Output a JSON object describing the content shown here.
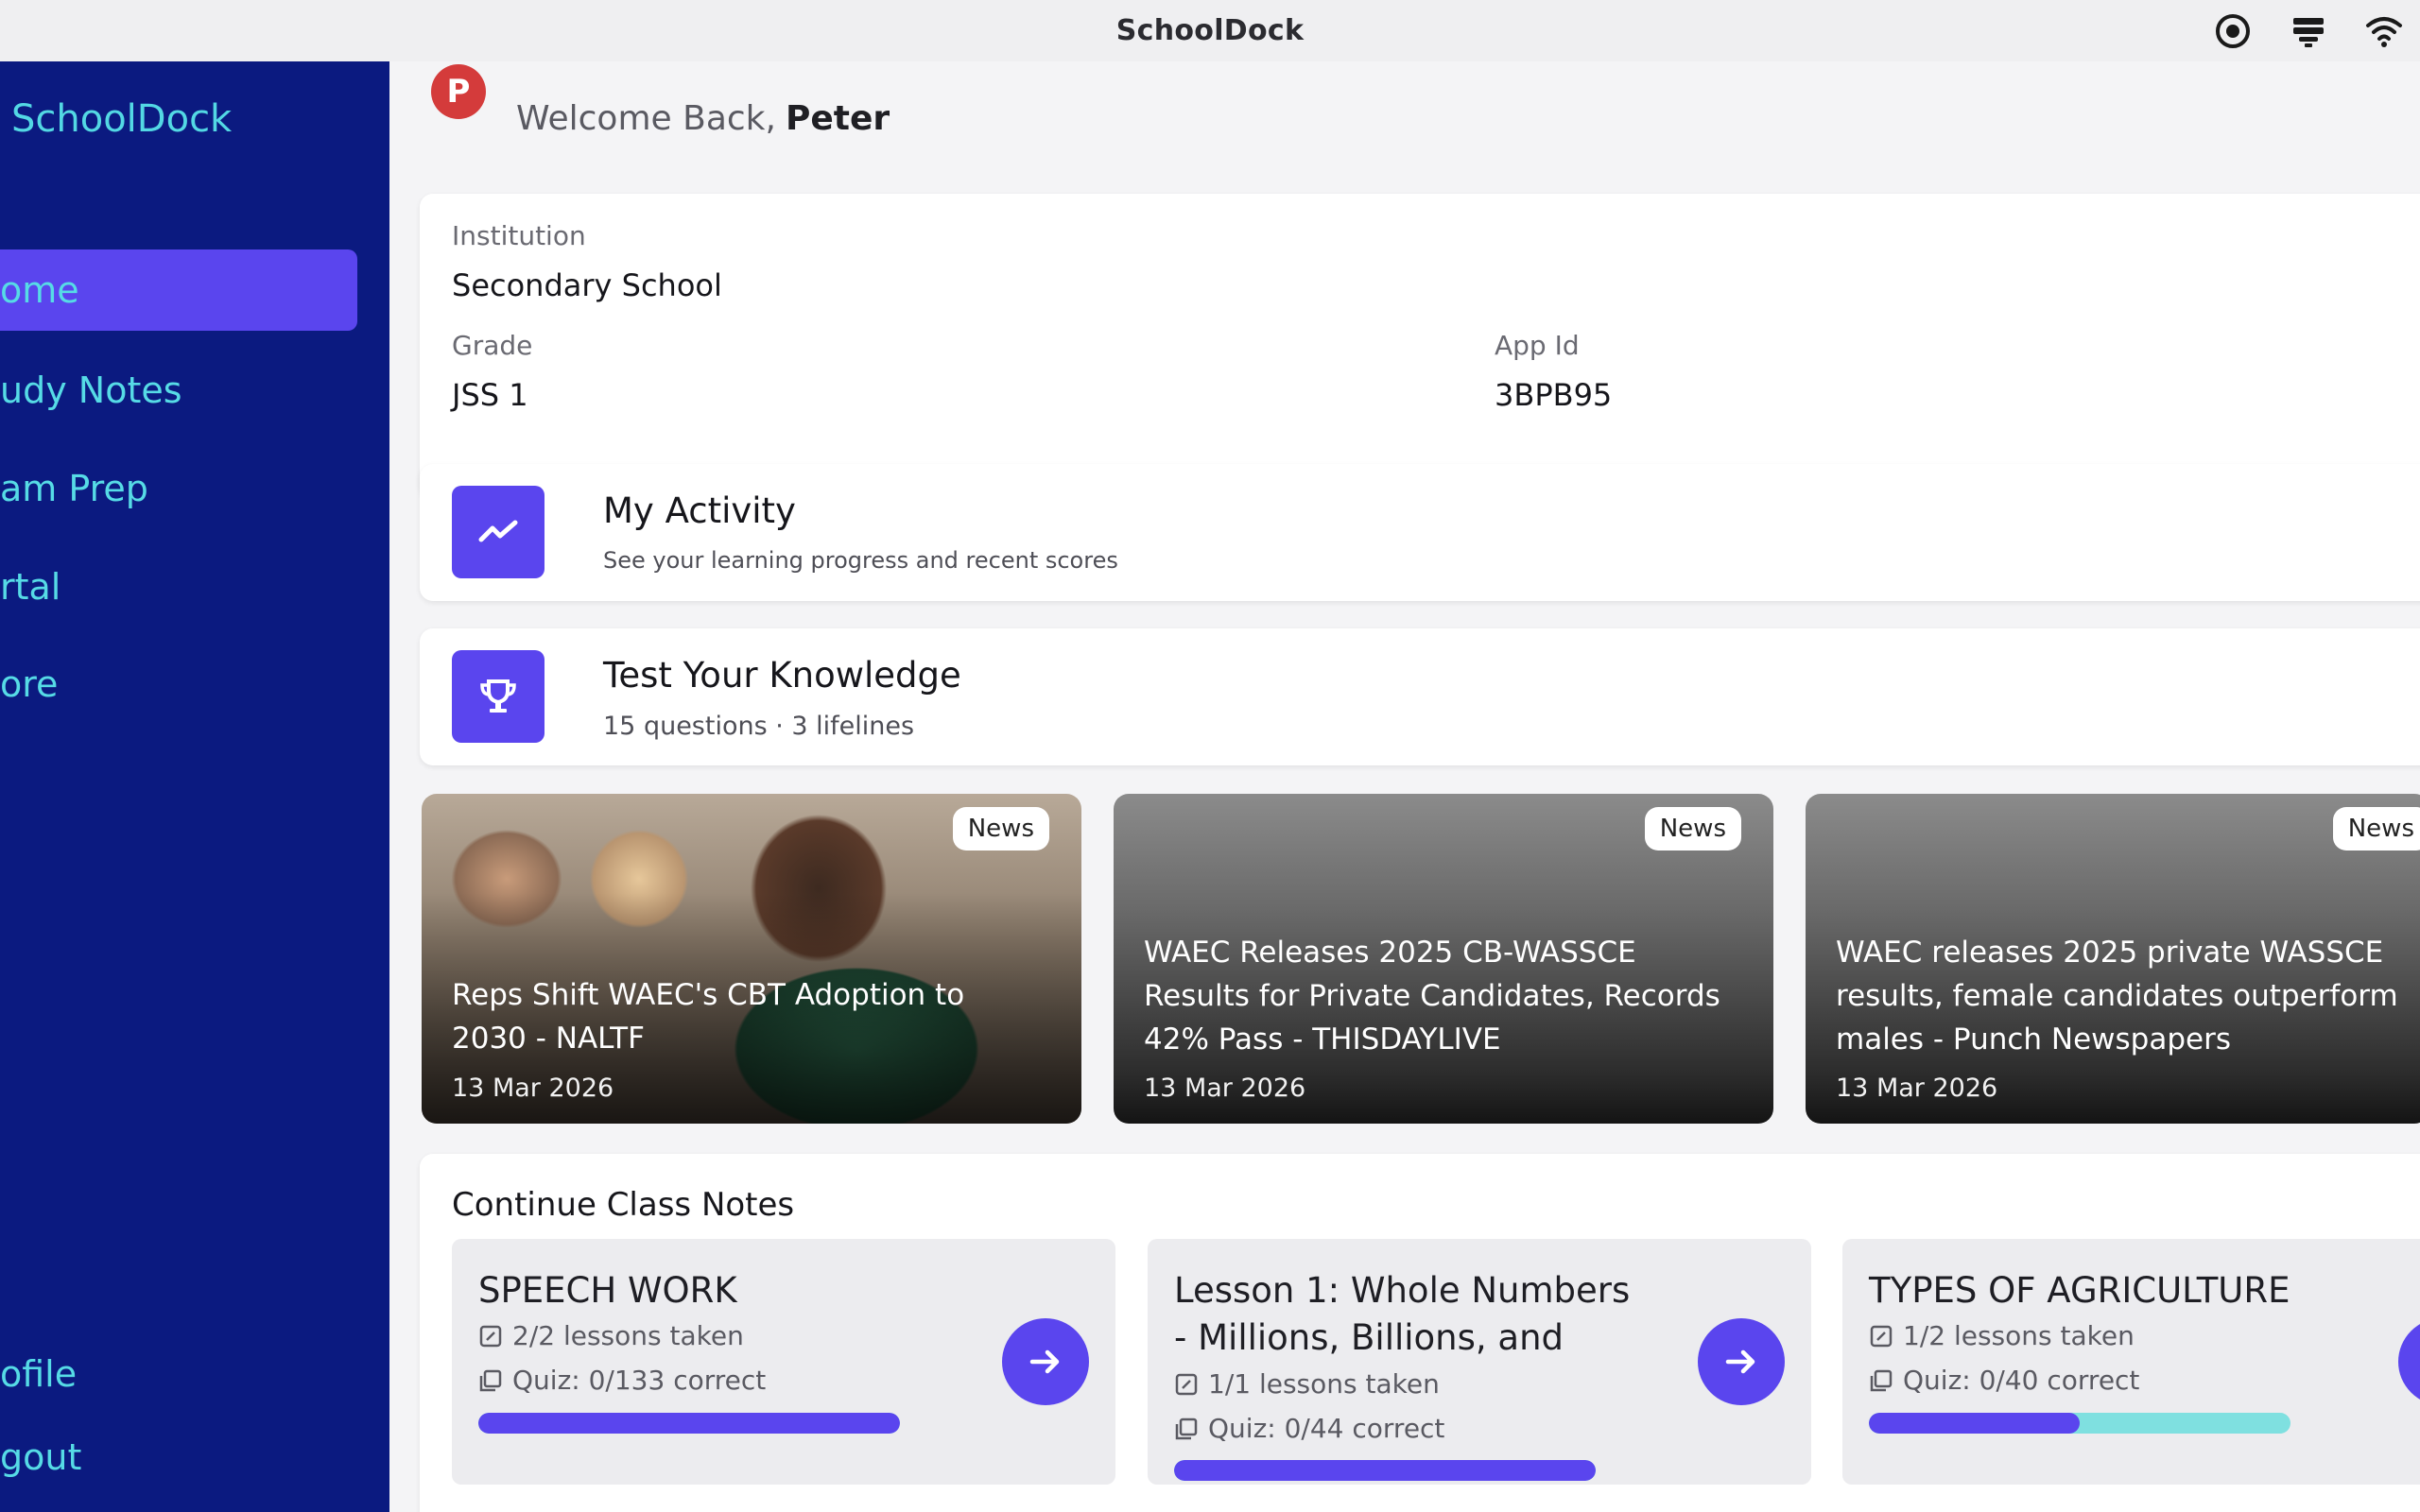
{
  "app": {
    "title": "SchoolDock"
  },
  "topbar": {
    "icons": [
      "record-icon",
      "server-icon",
      "wifi-icon"
    ]
  },
  "sidebar": {
    "brand": "SchoolDock",
    "items": [
      {
        "label": "ome",
        "icon": "home",
        "active": true
      },
      {
        "label": "udy Notes",
        "icon": "notes",
        "active": false
      },
      {
        "label": "am Prep",
        "icon": "exam",
        "active": false
      },
      {
        "label": "rtal",
        "icon": "portal",
        "active": false
      },
      {
        "label": "ore",
        "icon": "more",
        "active": false
      }
    ],
    "bottom_items": [
      {
        "label": "ofile"
      },
      {
        "label": "gout"
      }
    ]
  },
  "header": {
    "avatar_letter": "P",
    "welcome_text": "Welcome Back,",
    "user_name": "Peter"
  },
  "profile": {
    "institution_label": "Institution",
    "institution_value": "Secondary School",
    "grade_label": "Grade",
    "grade_value": "JSS 1",
    "appid_label": "App Id",
    "appid_value": "3BPB95"
  },
  "actions": [
    {
      "title": "My Activity",
      "subtitle": "See your learning progress and recent scores",
      "icon": "trend-icon"
    },
    {
      "title": "Test Your Knowledge",
      "subtitle": "15 questions · 3 lifelines",
      "icon": "trophy-icon"
    }
  ],
  "news": [
    {
      "badge": "News",
      "headline": "Reps Shift WAEC's CBT Adoption to 2030 - NALTF",
      "date": "13 Mar 2026"
    },
    {
      "badge": "News",
      "headline": "WAEC Releases 2025 CB-WASSCE Results for Private Candidates, Records 42% Pass - THISDAYLIVE",
      "date": "13 Mar 2026"
    },
    {
      "badge": "News",
      "headline": "WAEC releases 2025 private WASSCE results, female candidates outperform males - Punch Newspapers",
      "date": "13 Mar 2026"
    }
  ],
  "class_notes": {
    "title": "Continue Class Notes",
    "items": [
      {
        "title": "SPEECH WORK",
        "lessons": "2/2 lessons taken",
        "quiz": "Quiz: 0/133 correct",
        "progress": 1.0
      },
      {
        "title": "Lesson 1: Whole Numbers - Millions, Billions, and",
        "lessons": "1/1 lessons taken",
        "quiz": "Quiz: 0/44 correct",
        "progress": 1.0
      },
      {
        "title": "TYPES OF AGRICULTURE",
        "lessons": "1/2 lessons taken",
        "quiz": "Quiz: 0/40 correct",
        "progress": 0.5
      }
    ]
  },
  "colors": {
    "sidebar": "#0b1a80",
    "accent": "#5a45ee",
    "sidebar_text": "#56dbe6",
    "progress_track": "#7fe0e0"
  }
}
